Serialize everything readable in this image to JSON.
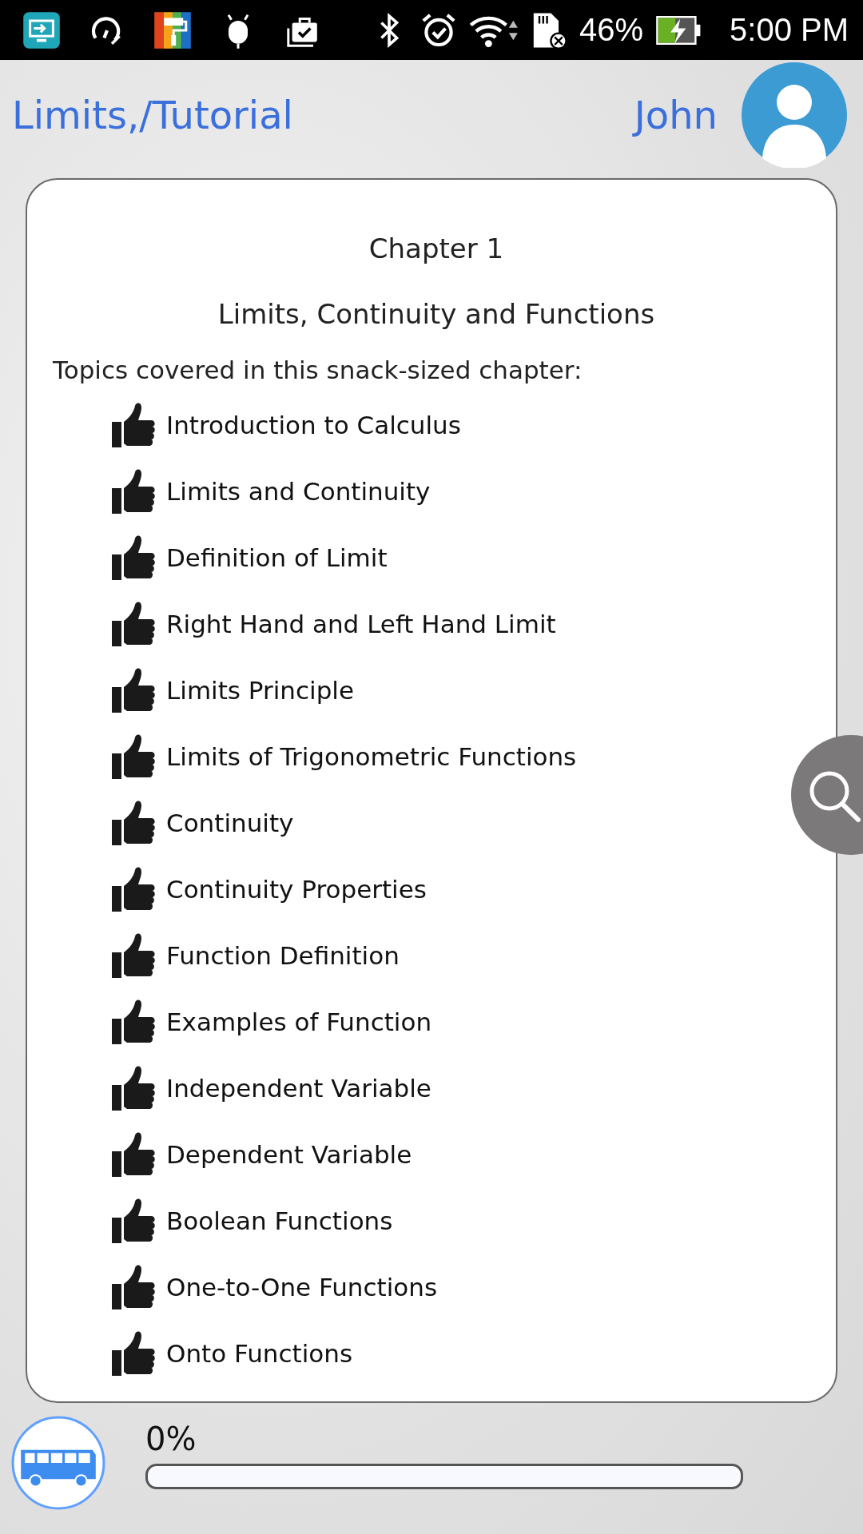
{
  "status_bar": {
    "battery": "46%",
    "time": "5:00 PM"
  },
  "header": {
    "title": "Limits,/Tutorial",
    "user_name": "John"
  },
  "chapter": {
    "number": "Chapter 1",
    "title": "Limits, Continuity and Functions",
    "intro": "Topics covered in this snack-sized chapter:",
    "topics": [
      "Introduction to Calculus",
      "Limits and Continuity",
      "Definition of Limit",
      "Right Hand and Left Hand Limit",
      "Limits Principle",
      "Limits of Trigonometric Functions",
      "Continuity",
      "Continuity Properties",
      "Function Definition",
      "Examples of Function",
      "Independent Variable",
      "Dependent Variable",
      "Boolean Functions",
      "One-to-One Functions",
      "Onto Functions"
    ]
  },
  "progress": {
    "reading": "0%",
    "level": 0
  }
}
